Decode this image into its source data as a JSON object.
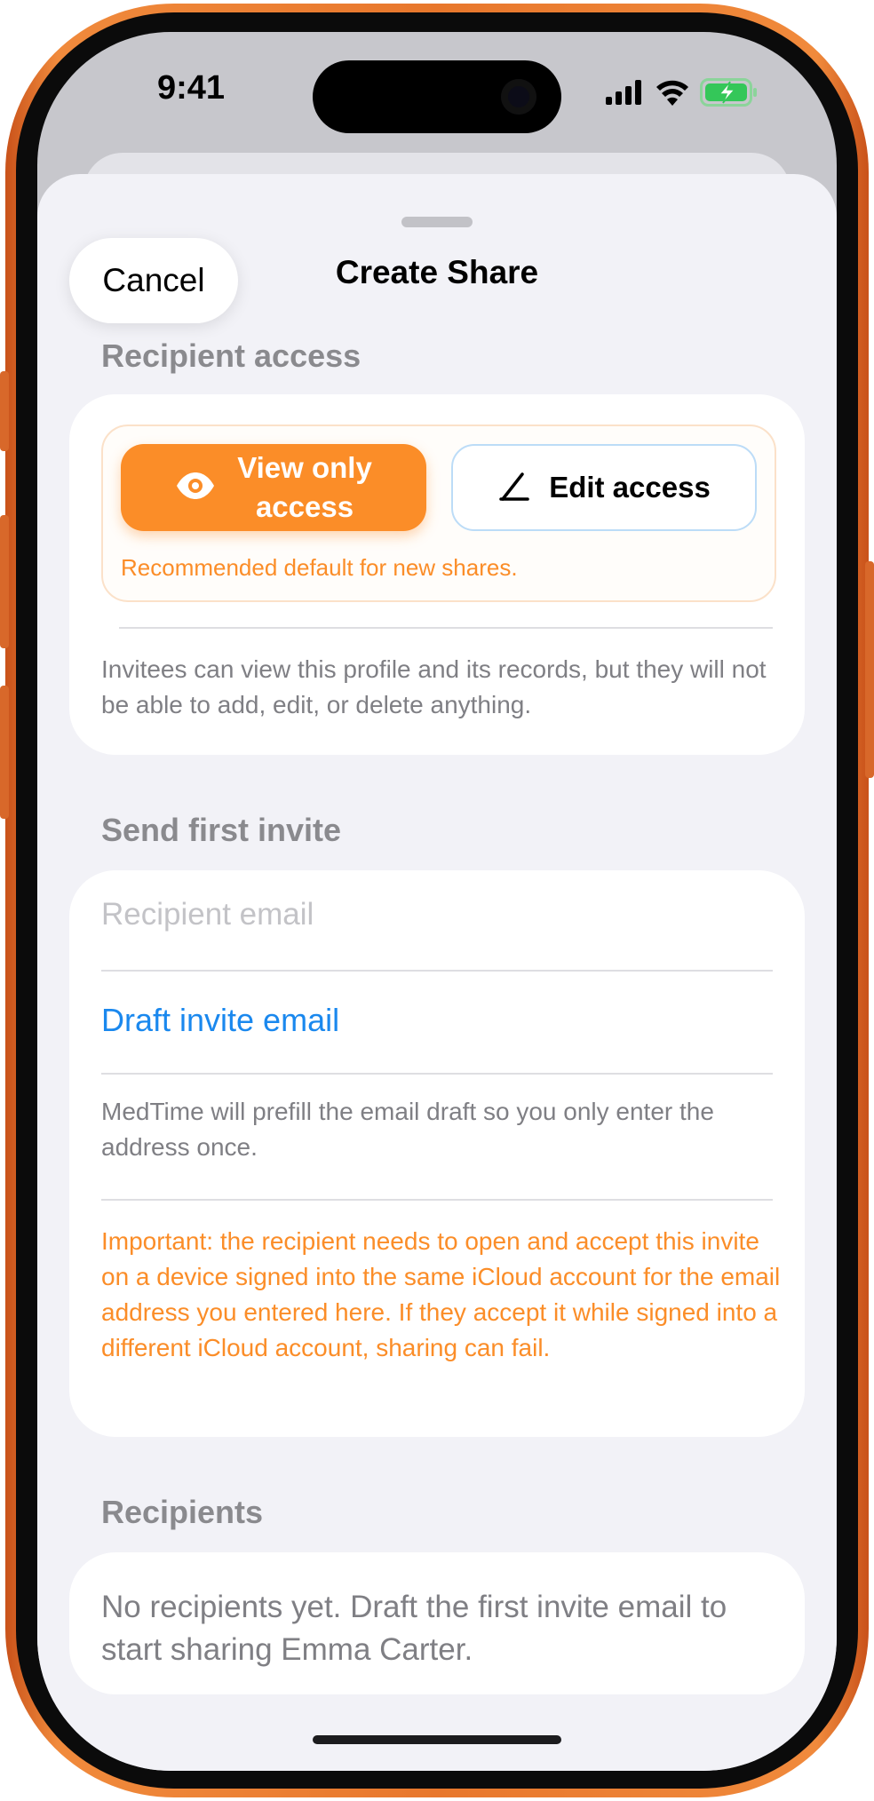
{
  "status_bar": {
    "time": "9:41"
  },
  "nav": {
    "cancel_label": "Cancel",
    "title": "Create Share"
  },
  "recipient_access": {
    "header": "Recipient access",
    "view_only_label": "View only access",
    "view_only_line1": "View only",
    "view_only_line2": "access",
    "edit_label": "Edit access",
    "selected": "View only access",
    "recommended_note": "Recommended default for new shares.",
    "description": "Invitees can view this profile and its records, but they will not be able to add, edit, or delete anything."
  },
  "send_invite": {
    "header": "Send first invite",
    "email_placeholder": "Recipient email",
    "email_value": "",
    "draft_label": "Draft invite email",
    "prefill_note": "MedTime will prefill the email draft so you only enter the address once.",
    "warning": "Important: the recipient needs to open and accept this invite on a device signed into the same iCloud account for the email address you entered here. If they accept it while signed into a different iCloud account, sharing can fail."
  },
  "recipients": {
    "header": "Recipients",
    "empty_message": "No recipients yet. Draft the first invite email to start sharing Emma Carter."
  },
  "colors": {
    "accent_orange": "#fb8d28",
    "link_blue": "#1a88ee",
    "frame_orange": "#e8772c",
    "battery_green": "#34c759"
  },
  "icons": [
    "signal-icon",
    "wifi-icon",
    "battery-charging-icon",
    "eye-icon",
    "pencil-icon"
  ]
}
